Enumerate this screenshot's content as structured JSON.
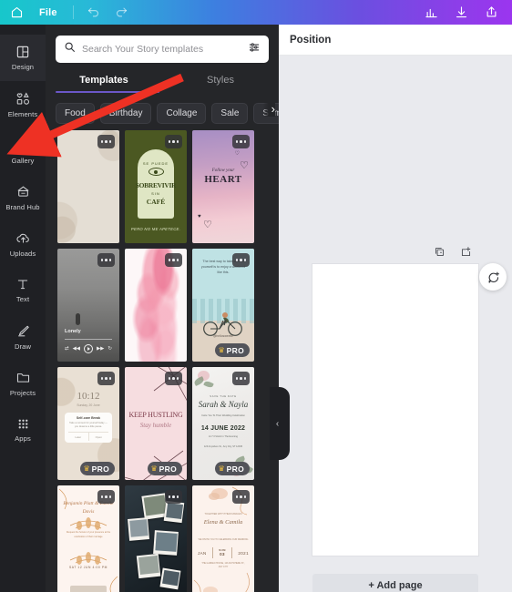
{
  "topbar": {
    "home_icon": "home-icon",
    "file_label": "File",
    "undo_icon": "undo-icon",
    "redo_icon": "redo-icon",
    "insights_icon": "bar-chart-icon",
    "download_icon": "download-icon",
    "share_icon": "share-icon",
    "gradient_start": "#17c7cb",
    "gradient_end": "#9b35ef"
  },
  "rail": {
    "items": [
      {
        "label": "Design",
        "icon": "layout-icon",
        "active": true
      },
      {
        "label": "Elements",
        "icon": "shapes-icon",
        "active": false
      },
      {
        "label": "Gallery",
        "icon": "camera-icon",
        "active": false
      },
      {
        "label": "Brand Hub",
        "icon": "brand-icon",
        "active": false
      },
      {
        "label": "Uploads",
        "icon": "upload-cloud-icon",
        "active": false
      },
      {
        "label": "Text",
        "icon": "text-icon",
        "active": false
      },
      {
        "label": "Draw",
        "icon": "pen-icon",
        "active": false
      },
      {
        "label": "Projects",
        "icon": "folder-icon",
        "active": false
      },
      {
        "label": "Apps",
        "icon": "grid-dots-icon",
        "active": false
      }
    ]
  },
  "panel": {
    "search": {
      "placeholder": "Search Your Story templates",
      "value": "",
      "search_icon": "search-icon",
      "filter_icon": "sliders-icon"
    },
    "tabs": [
      {
        "label": "Templates",
        "active": true
      },
      {
        "label": "Styles",
        "active": false
      }
    ],
    "tab_underline_color": "#6b57c8",
    "chips": [
      "Food",
      "Birthday",
      "Collage",
      "Sale",
      "Summer"
    ],
    "chips_next_icon": "chevron-right-icon",
    "pro_badge_label": "PRO",
    "pro_crown_icon": "crown-icon",
    "more_icon": "more-dots-icon",
    "templates": [
      {
        "name": "beige-texture-story",
        "pro": false,
        "text": {}
      },
      {
        "name": "sobrevivir-sin-cafe-story",
        "pro": false,
        "text": {
          "small": "SE PUEDE",
          "line1": "SOBREVIVIR",
          "line2": "SIN",
          "line3": "CAFÉ",
          "footer": "PERO NO ME APETECE."
        }
      },
      {
        "name": "follow-your-heart-sky-story",
        "pro": false,
        "text": {
          "script": "Follow your",
          "main": "HEART"
        }
      },
      {
        "name": "lonely-foggy-music-story",
        "pro": false,
        "text": {
          "title": "Lonely"
        }
      },
      {
        "name": "pink-watercolor-floral-story",
        "pro": false,
        "text": {}
      },
      {
        "name": "cyclist-weekend-quote-story",
        "pro": true,
        "text": {
          "quote": "The best way to take care of yourself is to enjoy a weekend like this.",
          "handle": "@hellosweetie"
        }
      },
      {
        "name": "lockscreen-notification-story",
        "pro": true,
        "text": {
          "clock": "10:12",
          "date": "Sunday, 20 June",
          "notif_title": "Self-care Break",
          "notif_body": "Take a moment for yourself today — you deserve a little pause.",
          "btn1": "Later",
          "btn2": "Open"
        }
      },
      {
        "name": "keep-hustling-pink-story",
        "pro": true,
        "text": {
          "line1": "KEEP HUSTLING",
          "line2": "Stay humble"
        }
      },
      {
        "name": "sarah-nayla-wedding-story",
        "pro": true,
        "text": {
          "pre": "SAVE THE DATE",
          "names": "Sarah & Nayla",
          "sub": "Invite You To Their Wedding Celebration",
          "date": "14 JUNE 2022",
          "time": "At 7 O'clock In The Evening",
          "address": "123 Anywhere St., Any City, ST 12345"
        }
      },
      {
        "name": "floral-gold-invitation-story",
        "pro": false,
        "text": {
          "names": "Benjamin Platt & Estelle Davis",
          "body": "Request the honour of your presence at the celebration of their marriage",
          "date": "SAT 12 JUN 4:00 PM"
        }
      },
      {
        "name": "polaroid-photo-collage-story",
        "pro": false,
        "text": {}
      },
      {
        "name": "elena-camila-invitation-story",
        "pro": false,
        "text": {
          "pre": "TOGETHER WITH THEIR FAMILIES",
          "names": "Elena & Camila",
          "sub": "WE INVITE YOU TO CELEBRATE OUR WEDDING",
          "m": "JAN",
          "d_label": "SUN",
          "d_num": "03",
          "y": "2021",
          "addr": "THE GARDEN HOUSE, 123 ANYWHERE ST., ANY CITY"
        }
      }
    ]
  },
  "handle": {
    "name": "collapse-panel-handle",
    "icon": "chevron-left-icon"
  },
  "editor": {
    "header_title": "Position",
    "duplicate_page_icon": "duplicate-page-icon",
    "add_page_icon": "add-page-icon",
    "comment_icon": "comment-plus-icon",
    "add_page_label": "+ Add page",
    "canvas_background": "#e9eaee",
    "page_background": "#ffffff"
  },
  "annotation": {
    "arrow_name": "red-pointer-arrow",
    "arrow_color": "#ee3124",
    "points_to": "Gallery"
  }
}
